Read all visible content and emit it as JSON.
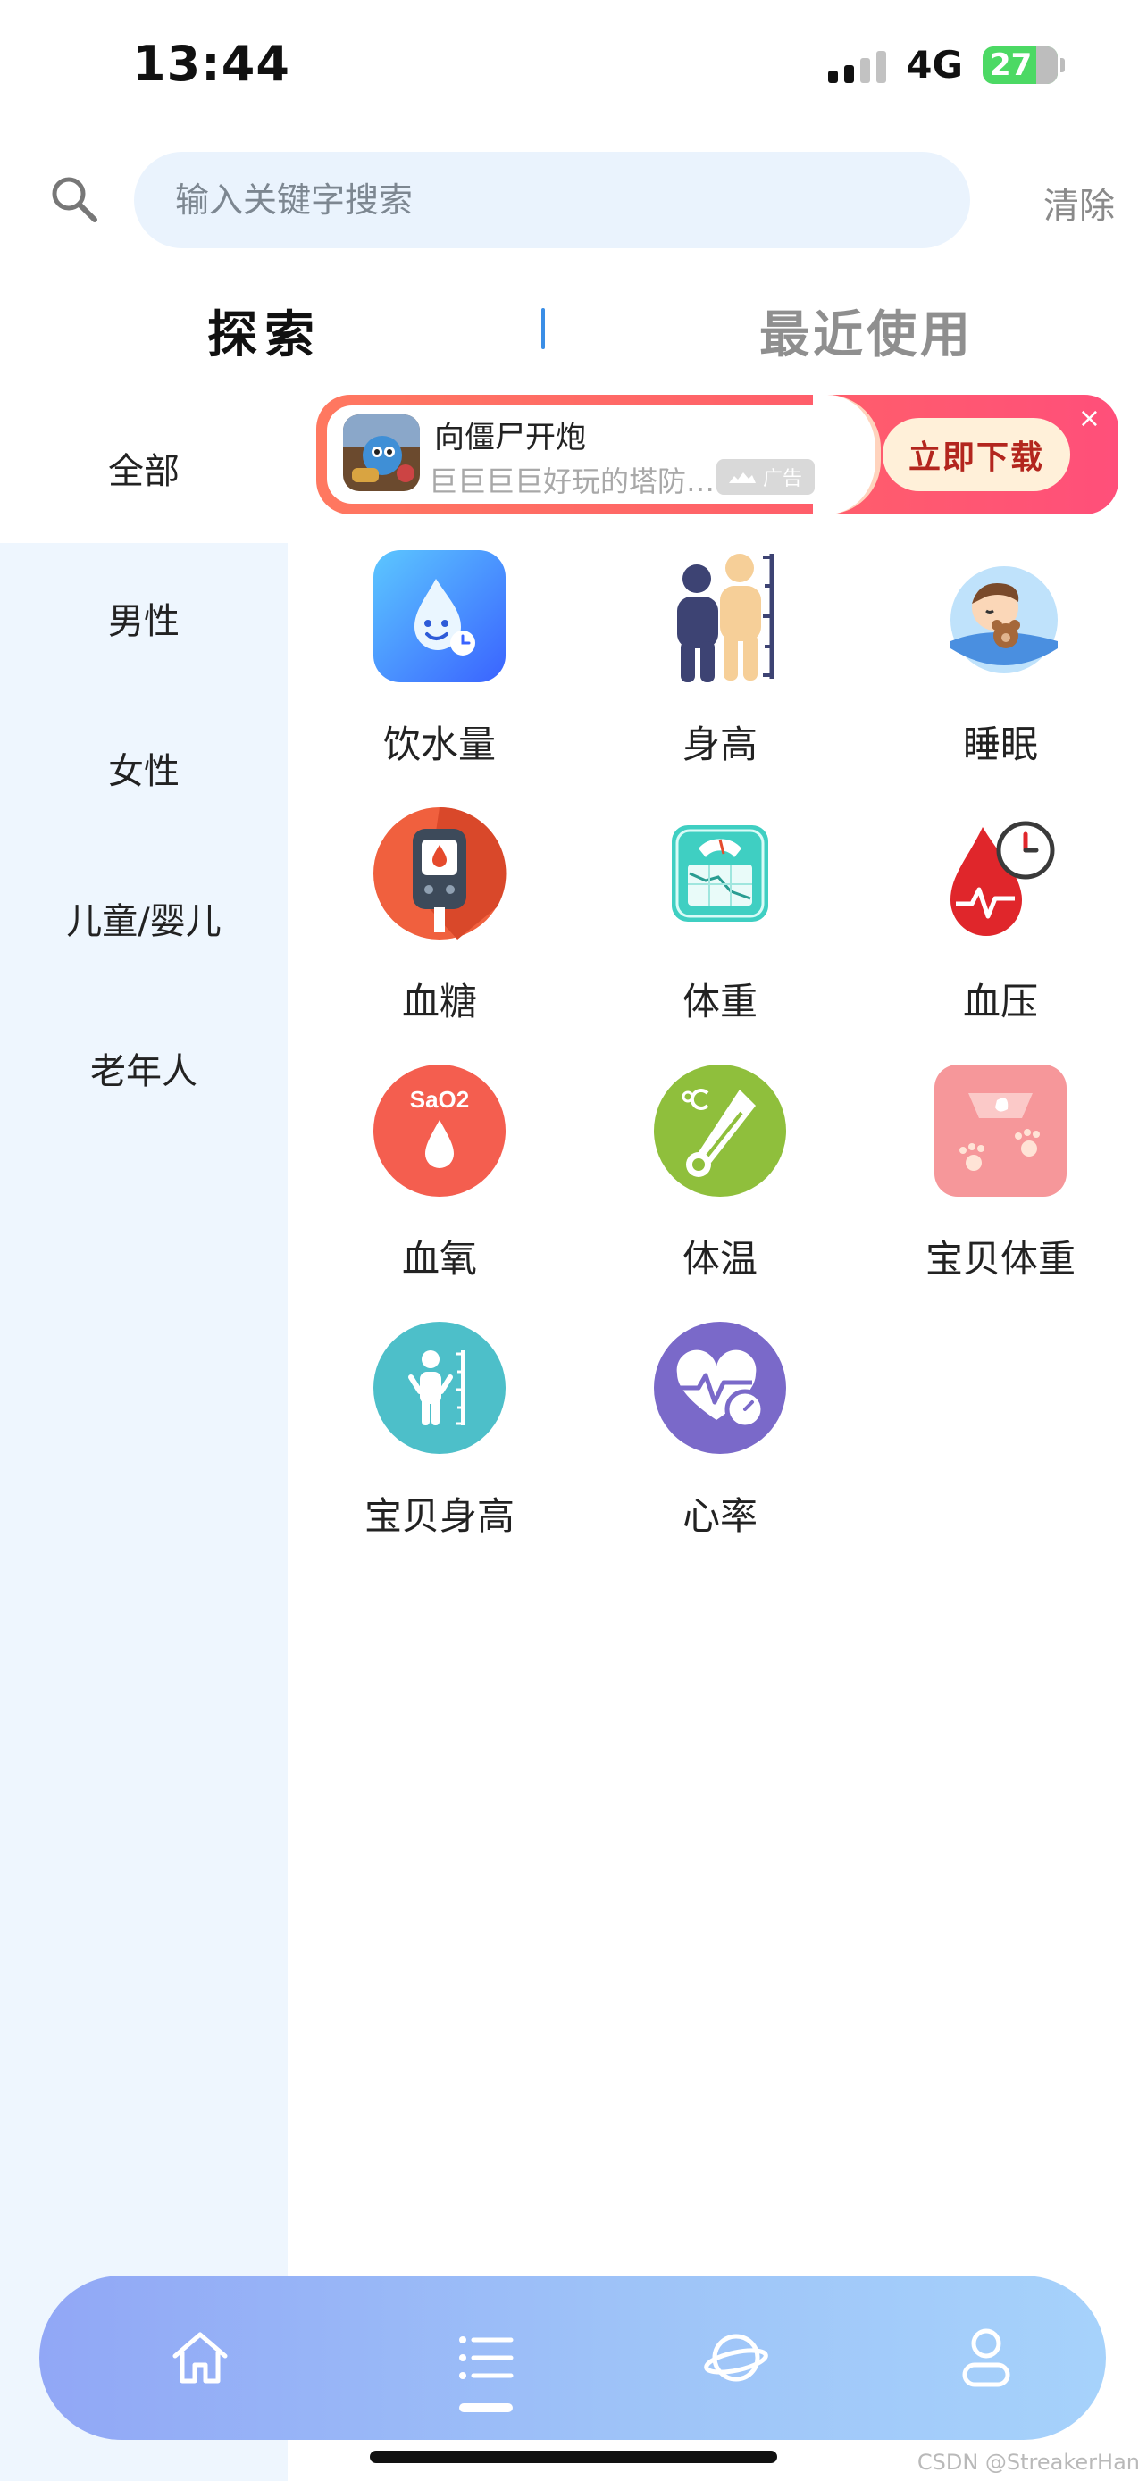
{
  "status_bar": {
    "time": "13:44",
    "network": "4G",
    "battery": "27"
  },
  "search": {
    "placeholder": "输入关键字搜索",
    "clear_label": "清除"
  },
  "tabs": [
    {
      "label": "探索"
    },
    {
      "label": "最近使用"
    }
  ],
  "sidebar": {
    "items": [
      {
        "label": "全部"
      },
      {
        "label": "男性"
      },
      {
        "label": "女性"
      },
      {
        "label": "儿童/婴儿"
      },
      {
        "label": "老年人"
      }
    ]
  },
  "ad": {
    "title": "向僵尸开炮",
    "subtitle": "巨巨巨巨好玩的塔防…",
    "tag": "广告",
    "cta": "立即下载",
    "close": "×"
  },
  "grid": {
    "items": [
      {
        "label": "饮水量",
        "icon": "water-drop-icon"
      },
      {
        "label": "身高",
        "icon": "height-icon"
      },
      {
        "label": "睡眠",
        "icon": "sleep-icon"
      },
      {
        "label": "血糖",
        "icon": "glucose-meter-icon"
      },
      {
        "label": "体重",
        "icon": "scale-icon"
      },
      {
        "label": "血压",
        "icon": "blood-pressure-icon"
      },
      {
        "label": "血氧",
        "icon": "blood-oxygen-icon",
        "text": "SaO2"
      },
      {
        "label": "体温",
        "icon": "thermometer-icon"
      },
      {
        "label": "宝贝体重",
        "icon": "baby-scale-icon"
      },
      {
        "label": "宝贝身高",
        "icon": "baby-height-icon"
      },
      {
        "label": "心率",
        "icon": "heart-rate-icon"
      }
    ]
  },
  "tabbar": {
    "items": [
      "home-icon",
      "list-icon",
      "planet-icon",
      "user-icon"
    ],
    "active": 1
  },
  "watermark": "CSDN @StreakerHan"
}
